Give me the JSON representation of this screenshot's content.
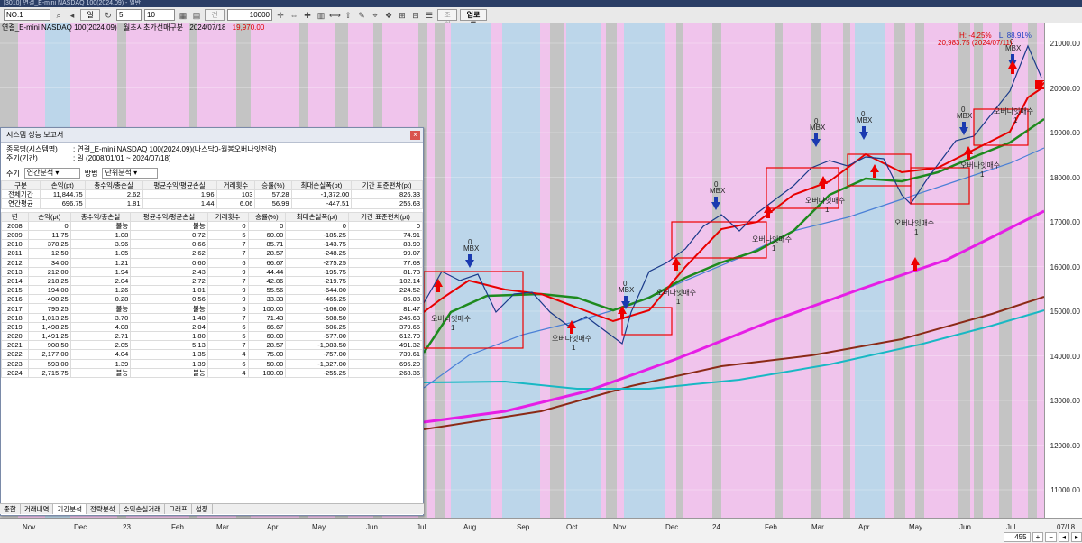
{
  "window": {
    "title": "[3010] 연결_E-mini NASDAQ 100(2024.09) - 일반"
  },
  "toolbar": {
    "code": "NO.1",
    "period": "일",
    "count_a": "5",
    "count_b": "10",
    "option_label": "건수",
    "count_value": "10000",
    "button_label": "조회",
    "upload_label": "업로드"
  },
  "chart_header": {
    "symbol": "연결_E-mini NASDAQ 100(2024.09)",
    "study": "월초시초가선매구분",
    "date": "2024/07/18",
    "price": "19,970.00"
  },
  "annotations": {
    "high_pct": "H: -4.25%",
    "low_pct": "L: 88.91%",
    "high_label": "20,983.75 (2024/07/11)",
    "current_price": "20092.50"
  },
  "y_axis": [
    "21000.00",
    "20000.00",
    "19000.00",
    "18000.00",
    "17000.00",
    "16000.00",
    "15000.00",
    "14000.00",
    "13000.00",
    "12000.00",
    "11000.00"
  ],
  "x_axis": [
    "Nov",
    "Dec",
    "23",
    "Feb",
    "Mar",
    "Apr",
    "May",
    "Jun",
    "Jul",
    "Aug",
    "Sep",
    "Oct",
    "Nov",
    "Dec",
    "24",
    "Feb",
    "Mar",
    "Apr",
    "May",
    "Jun",
    "Jul",
    "07/18"
  ],
  "signal_labels": {
    "mbx": "MBX",
    "zero": "0",
    "buy": "오버나잇매수",
    "one": "1"
  },
  "report": {
    "title": "시스템 성능 보고서",
    "item_label": "종목명(시스템명)",
    "item_value": ": 연결_E-mini NASDAQ 100(2024.09)(나스닥0-월봉오버나잇전략)",
    "period_label": "주기(기간)",
    "period_value": ": 일 (2008/01/01 ~ 2024/07/18)",
    "period_select_label": "주기",
    "period_select_value": "연간분석",
    "method_label": "방법",
    "method_value": "단위분석",
    "summary_headers": [
      "구분",
      "손익(pt)",
      "총수익/총손실",
      "평균수익/평균손실",
      "거래횟수",
      "승률(%)",
      "최대손실폭(pt)",
      "기간 표준편차(pt)"
    ],
    "summary_rows": [
      [
        "전체기간",
        "11,844.75",
        "2.62",
        "1.96",
        "103",
        "57.28",
        "-1,372.00",
        "826.33"
      ],
      [
        "연간평균",
        "696.75",
        "1.81",
        "1.44",
        "6.06",
        "56.99",
        "-447.51",
        "255.63"
      ]
    ],
    "year_headers": [
      "년",
      "손익(pt)",
      "총수익/총손실",
      "평균수익/평균손실",
      "거래횟수",
      "승률(%)",
      "최대손실폭(pt)",
      "기간 표준편차(pt)"
    ],
    "year_rows": [
      [
        "2008",
        "0",
        "불능",
        "불능",
        "0",
        "0",
        "0",
        "0"
      ],
      [
        "2009",
        "11.75",
        "1.08",
        "0.72",
        "5",
        "60.00",
        "-185.25",
        "74.91"
      ],
      [
        "2010",
        "378.25",
        "3.96",
        "0.66",
        "7",
        "85.71",
        "-143.75",
        "83.90"
      ],
      [
        "2011",
        "12.50",
        "1.05",
        "2.62",
        "7",
        "28.57",
        "-248.25",
        "99.07"
      ],
      [
        "2012",
        "34.00",
        "1.21",
        "0.60",
        "6",
        "66.67",
        "-275.25",
        "77.68"
      ],
      [
        "2013",
        "212.00",
        "1.94",
        "2.43",
        "9",
        "44.44",
        "-195.75",
        "81.73"
      ],
      [
        "2014",
        "218.25",
        "2.04",
        "2.72",
        "7",
        "42.86",
        "-219.75",
        "102.14"
      ],
      [
        "2015",
        "194.00",
        "1.26",
        "1.01",
        "9",
        "55.56",
        "-644.00",
        "224.52"
      ],
      [
        "2016",
        "-408.25",
        "0.28",
        "0.56",
        "9",
        "33.33",
        "-465.25",
        "86.88"
      ],
      [
        "2017",
        "795.25",
        "불능",
        "불능",
        "5",
        "100.00",
        "-166.00",
        "81.47"
      ],
      [
        "2018",
        "1,013.25",
        "3.70",
        "1.48",
        "7",
        "71.43",
        "-508.50",
        "245.63"
      ],
      [
        "2019",
        "1,498.25",
        "4.08",
        "2.04",
        "6",
        "66.67",
        "-606.25",
        "379.65"
      ],
      [
        "2020",
        "1,491.25",
        "2.71",
        "1.80",
        "5",
        "60.00",
        "-577.00",
        "612.70"
      ],
      [
        "2021",
        "908.50",
        "2.05",
        "5.13",
        "7",
        "28.57",
        "-1,083.50",
        "491.32"
      ],
      [
        "2022",
        "2,177.00",
        "4.04",
        "1.35",
        "4",
        "75.00",
        "-757.00",
        "739.61"
      ],
      [
        "2023",
        "593.00",
        "1.39",
        "1.39",
        "6",
        "50.00",
        "-1,327.00",
        "696.20"
      ],
      [
        "2024",
        "2,715.75",
        "불능",
        "불능",
        "4",
        "100.00",
        "-255.25",
        "268.36"
      ]
    ],
    "tabs": [
      "종합",
      "거래내역",
      "기간분석",
      "전략분석",
      "수익손실거래",
      "그래프",
      "설정"
    ],
    "active_tab": "기간분석"
  },
  "nav": {
    "zoom": "455"
  },
  "colors": {
    "pink_band": "#f0c4ec",
    "blue_band": "#bcd6ea",
    "gray_band": "#c4c4c4",
    "ma_red": "#e80000",
    "ma_green": "#1e8a1e",
    "ma_blue": "#4a7fd6",
    "ma_magenta": "#e61ee6",
    "ma_cyan": "#18b8c4",
    "ma_brown": "#8b2a16"
  }
}
